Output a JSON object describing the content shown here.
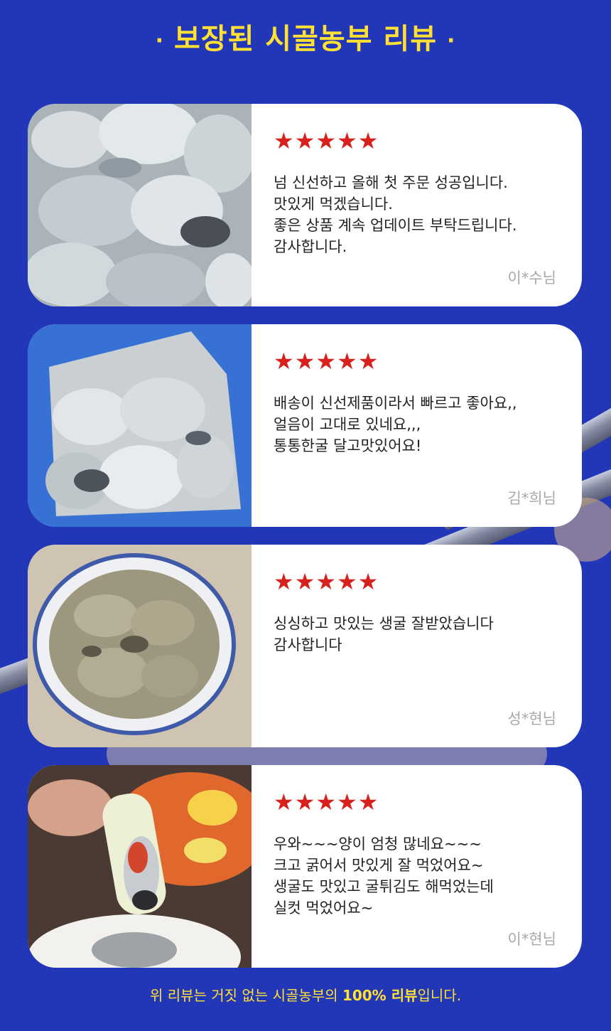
{
  "header": {
    "dot_left": "·",
    "title": "보장된 시골농부 리뷰",
    "dot_right": "·"
  },
  "colors": {
    "background": "#2236b8",
    "accent_yellow": "#ffe033",
    "star_red": "#d8201c",
    "author_gray": "#a8a8a8"
  },
  "reviews": [
    {
      "photo_icon": "raw-oysters-photo",
      "stars": "★★★★★",
      "rating": 5,
      "lines": [
        "넘 신선하고 올해 첫 주문 성공입니다.",
        "맛있게 먹겠습니다.",
        "좋은 상품 계속 업데이트 부탁드립니다.",
        "감사합니다."
      ],
      "author": "이*수님"
    },
    {
      "photo_icon": "bagged-oysters-photo",
      "stars": "★★★★★",
      "rating": 5,
      "lines": [
        "배송이 신선제품이라서 빠르고 좋아요,,",
        "얼음이 고대로 있네요,,,",
        "통통한굴 달고맛있어요!"
      ],
      "author": "김*희님"
    },
    {
      "photo_icon": "oysters-in-bowl-photo",
      "stars": "★★★★★",
      "rating": 5,
      "lines": [
        "싱싱하고 맛있는 생굴 잘받았습니다",
        "감사합니다"
      ],
      "author": "성*현님"
    },
    {
      "photo_icon": "oyster-with-kimchi-photo",
      "stars": "★★★★★",
      "rating": 5,
      "lines": [
        "우와~~~양이 엄청 많네요~~~",
        "크고 굵어서 맛있게 잘 먹었어요~",
        "생굴도 맛있고 굴튀김도 해먹었는데",
        "실컷 먹었어요~"
      ],
      "author": "이*현님"
    }
  ],
  "footer": {
    "prefix": "위 리뷰는 거짓 없는 시골농부의 ",
    "highlight": "100% 리뷰",
    "suffix": "입니다."
  }
}
